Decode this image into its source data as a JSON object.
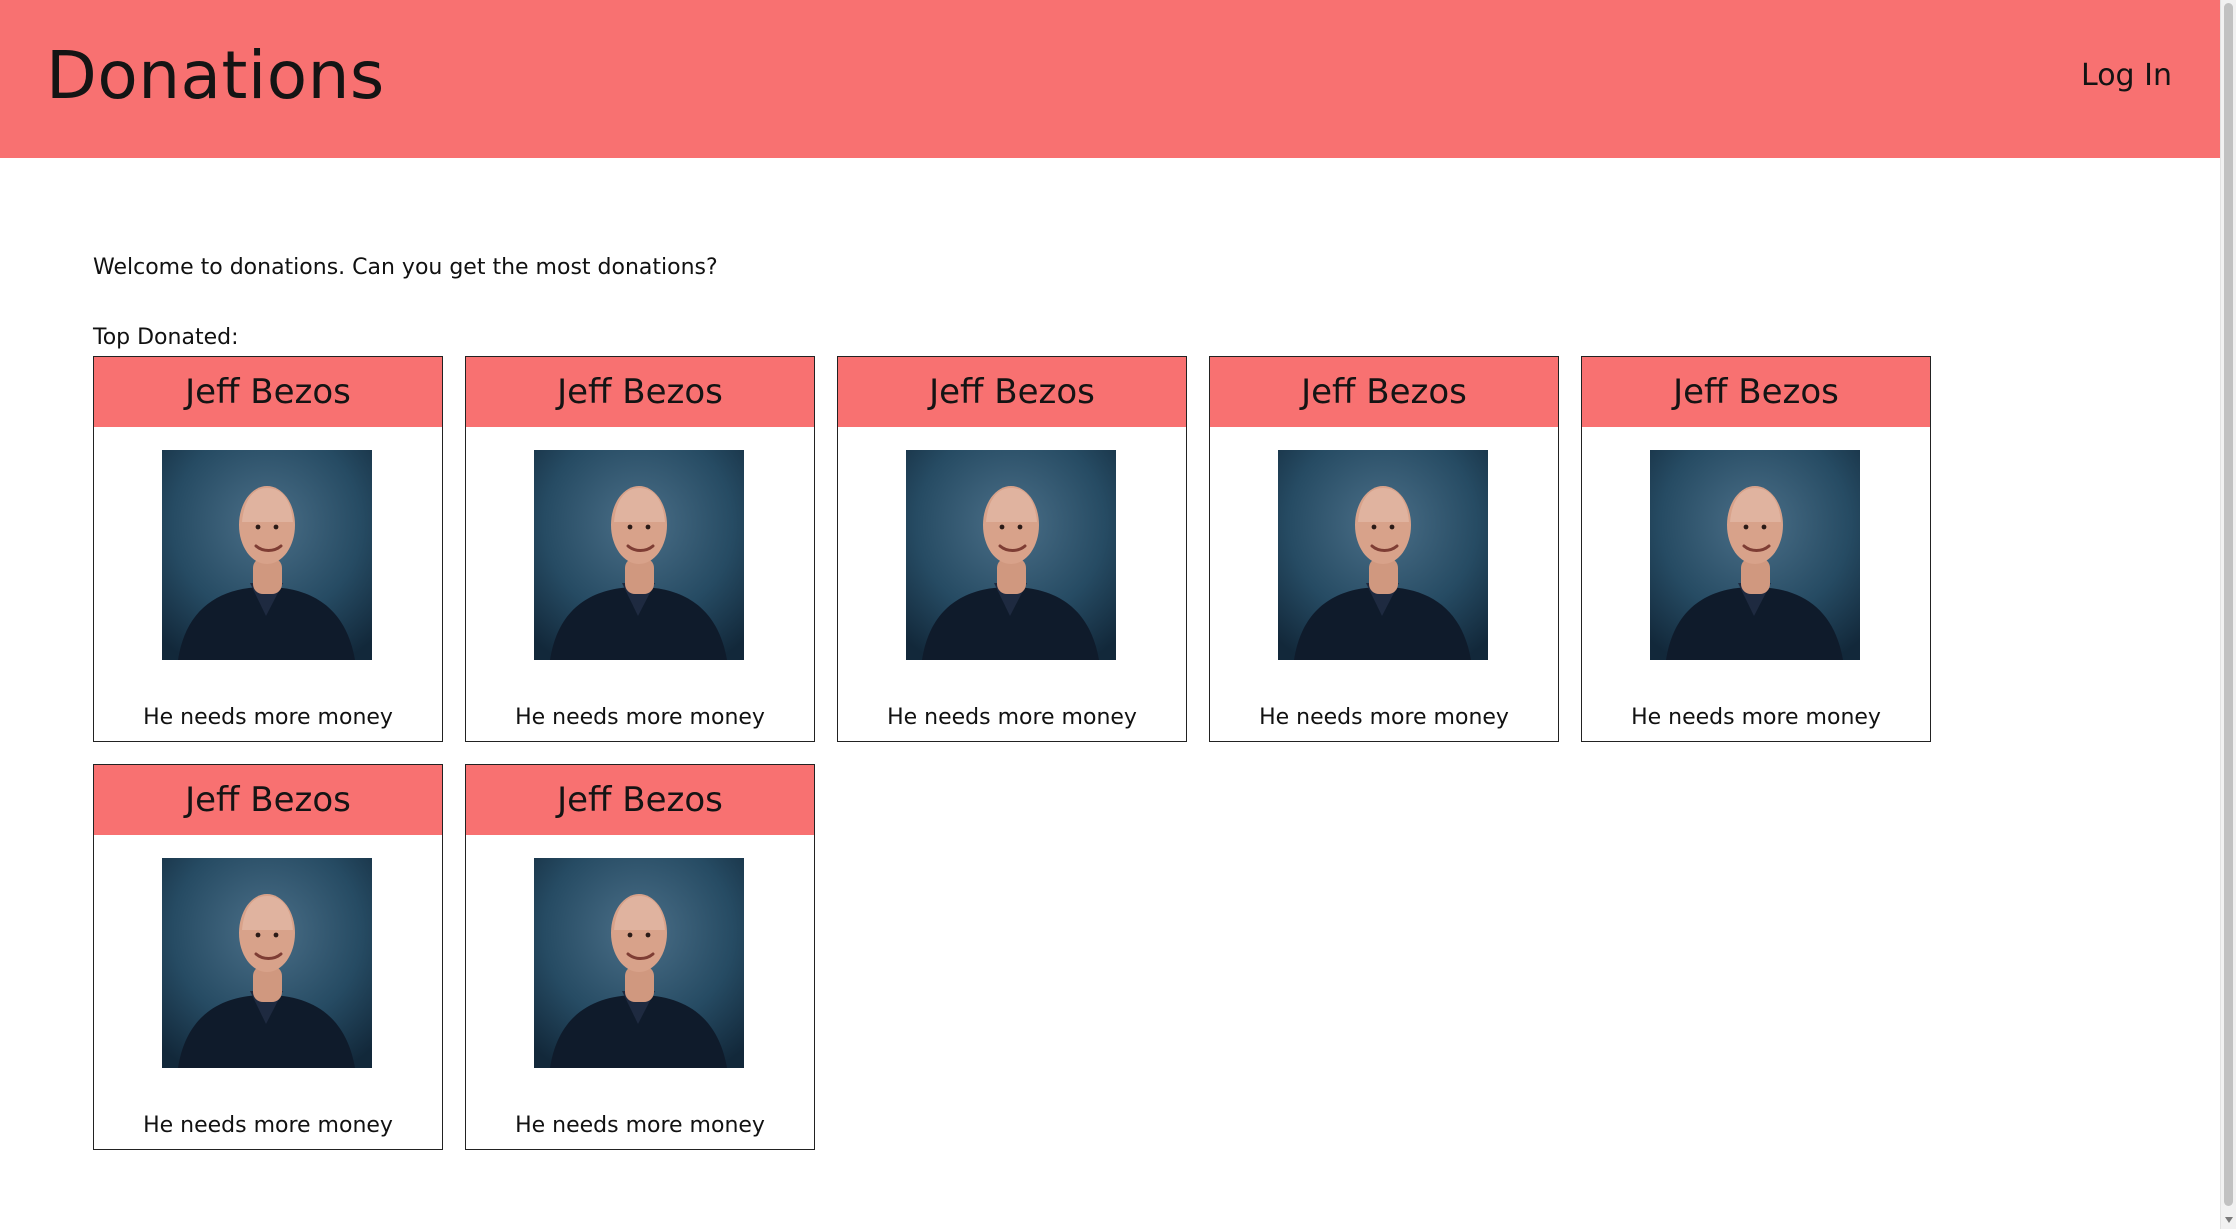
{
  "header": {
    "title": "Donations",
    "login_label": "Log In",
    "color": "#f87171"
  },
  "main": {
    "welcome": "Welcome to donations. Can you get the most donations?",
    "top_label": "Top Donated:"
  },
  "cards": [
    {
      "name": "Jeff Bezos",
      "caption": "He needs more money",
      "image": "portrait-photo"
    },
    {
      "name": "Jeff Bezos",
      "caption": "He needs more money",
      "image": "portrait-photo"
    },
    {
      "name": "Jeff Bezos",
      "caption": "He needs more money",
      "image": "portrait-photo"
    },
    {
      "name": "Jeff Bezos",
      "caption": "He needs more money",
      "image": "portrait-photo"
    },
    {
      "name": "Jeff Bezos",
      "caption": "He needs more money",
      "image": "portrait-photo"
    },
    {
      "name": "Jeff Bezos",
      "caption": "He needs more money",
      "image": "portrait-photo"
    },
    {
      "name": "Jeff Bezos",
      "caption": "He needs more money",
      "image": "portrait-photo"
    }
  ]
}
